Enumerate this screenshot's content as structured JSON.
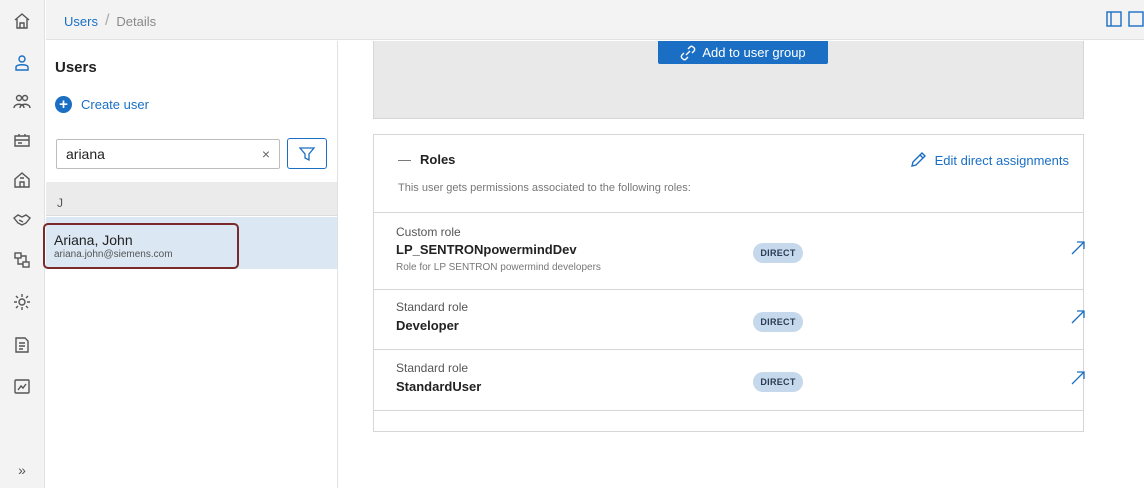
{
  "breadcrumb": {
    "root": "Users",
    "separator": "/",
    "current": "Details"
  },
  "sidebar": {
    "icons": [
      "home-icon",
      "user-icon",
      "users-group-icon",
      "roles-icon",
      "building-icon",
      "handshake-icon",
      "network-icon",
      "settings-gear-icon",
      "document-icon",
      "screen-icon",
      "expand-icon"
    ],
    "expand_label": "»"
  },
  "list": {
    "title": "Users",
    "create_label": "Create user",
    "search_value": "ariana",
    "clear_symbol": "×",
    "group_letter": "J",
    "users": [
      {
        "name": "Ariana, John",
        "email": "ariana.john@siemens.com"
      }
    ]
  },
  "groups": {
    "add_label": "Add to user group"
  },
  "roles": {
    "collapse_symbol": "—",
    "title": "Roles",
    "description": "This user gets permissions associated to the following roles:",
    "edit_label": "Edit direct assignments",
    "items": [
      {
        "kind": "Custom role",
        "name": "LP_SENTRONpowermindDev",
        "subtitle": "Role for LP SENTRON powermind developers",
        "badge": "DIRECT"
      },
      {
        "kind": "Standard role",
        "name": "Developer",
        "subtitle": "",
        "badge": "DIRECT"
      },
      {
        "kind": "Standard role",
        "name": "StandardUser",
        "subtitle": "",
        "badge": "DIRECT"
      }
    ]
  },
  "colors": {
    "accent": "#1a6fc4",
    "selection": "#dbe7f3",
    "badge": "#c5d8ec",
    "highlight_border": "#7a2a2a"
  }
}
